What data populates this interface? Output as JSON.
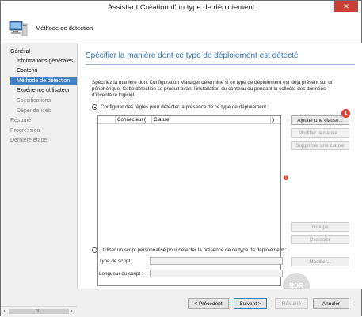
{
  "window": {
    "title": "Assistant Création d'un type de déploiement",
    "close": "✕"
  },
  "header": {
    "title": "Méthode de détection",
    "icon": "computer-icon"
  },
  "sidebar": {
    "items": [
      {
        "label": "Général",
        "level": 0,
        "state": "normal"
      },
      {
        "label": "Informations générales",
        "level": 1,
        "state": "normal"
      },
      {
        "label": "Contenu",
        "level": 1,
        "state": "normal"
      },
      {
        "label": "Méthode de détection",
        "level": 1,
        "state": "active"
      },
      {
        "label": "Expérience utilisateur",
        "level": 1,
        "state": "normal"
      },
      {
        "label": "Spécifications",
        "level": 1,
        "state": "disabled"
      },
      {
        "label": "Dépendances",
        "level": 1,
        "state": "disabled"
      },
      {
        "label": "Résumé",
        "level": 0,
        "state": "disabled"
      },
      {
        "label": "Progression",
        "level": 0,
        "state": "disabled"
      },
      {
        "label": "Dernière étape",
        "level": 0,
        "state": "disabled"
      }
    ],
    "scroll_center": "III"
  },
  "main": {
    "title": "Spécifier la manière dont ce type de déploiement est détecté",
    "description": "Spécifiez la manière dont Configuration Manager détermine si ce type de déploiement est déjà présent sur un périphérique. Cette détection se produit avant l'installation du contenu ou pendant la collecte des données d'inventaire logiciel.",
    "option_rules": {
      "label": "Configurer des règles pour détecter la présence de ce type de déploiement :",
      "checked": true
    },
    "grid": {
      "columns": [
        "",
        "Connecteur",
        "(",
        "Clause",
        ")"
      ]
    },
    "buttons": {
      "add_clause": "Ajouter une clause...",
      "modify_clause": "Modifier la clause...",
      "delete_clause": "Supprimer une clause",
      "group": "Groupe",
      "ungroup": "Dissocier",
      "modify": "Modifier..."
    },
    "option_script": {
      "label": "Utiliser un script personnalisé pour détecter la présence de ce type de déploiement :",
      "checked": false
    },
    "script_type_label": "Type de script :",
    "script_length_label": "Longueur du script :",
    "badge": "1",
    "error_glyph": "!"
  },
  "footer": {
    "previous": "< Précédent",
    "next": "Suivant >",
    "summary": "Résumé",
    "cancel": "Annuler"
  },
  "watermark": "RDR"
}
